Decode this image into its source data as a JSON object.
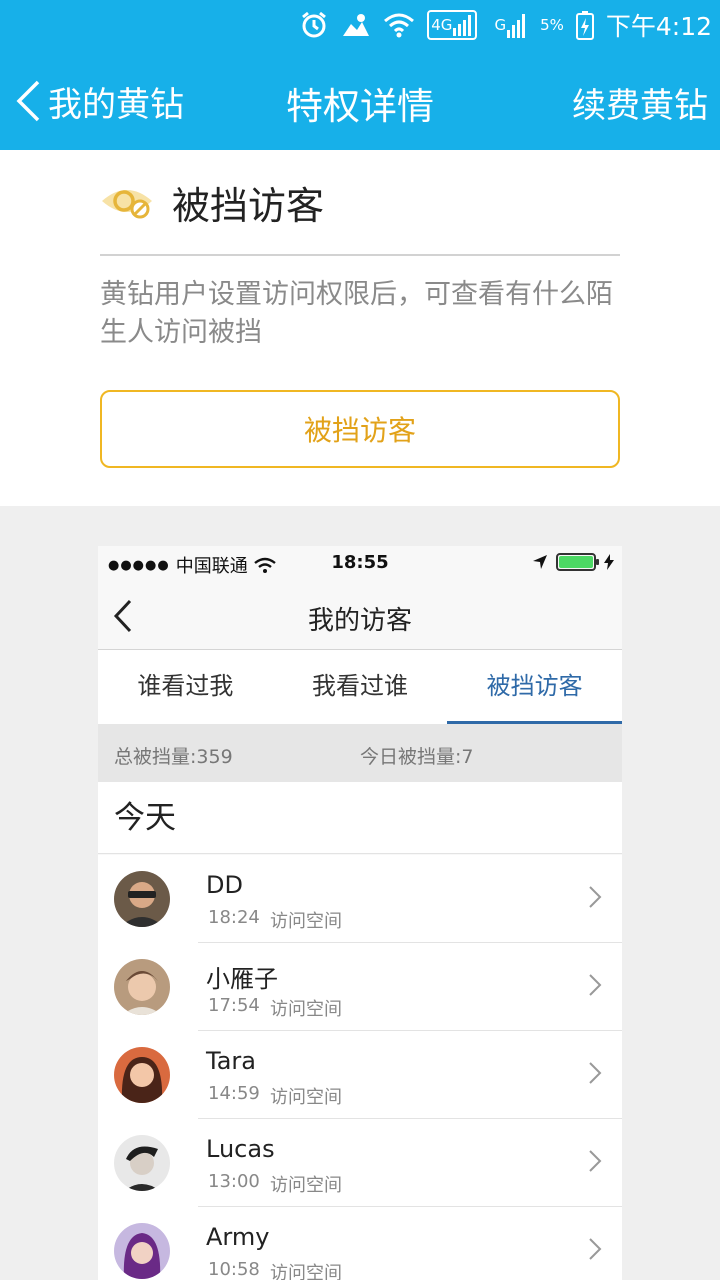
{
  "status_bar": {
    "network_4g": "4G",
    "network_g": "G",
    "battery": "5%",
    "time": "下午4:12"
  },
  "header": {
    "back_label": "我的黄钻",
    "title": "特权详情",
    "action_label": "续费黄钻"
  },
  "privilege": {
    "title": "被挡访客",
    "description": "黄钻用户设置访问权限后，可查看有什么陌生人访问被挡",
    "button_label": "被挡访客",
    "accent_color": "#f0b723"
  },
  "preview": {
    "status": {
      "signal_dots": "●●●●●",
      "carrier": "中国联通",
      "time": "18:55"
    },
    "nav_title": "我的访客",
    "tabs": [
      {
        "label": "谁看过我",
        "active": false
      },
      {
        "label": "我看过谁",
        "active": false
      },
      {
        "label": "被挡访客",
        "active": true
      }
    ],
    "stats": {
      "total": "总被挡量:359",
      "today": "今日被挡量:7"
    },
    "section_title": "今天",
    "visitors": [
      {
        "name": "DD",
        "time": "18:24",
        "action": "访问空间",
        "avatar_color": "#5b4a3a"
      },
      {
        "name": "小雁子",
        "time": "17:54",
        "action": "访问空间",
        "avatar_color": "#8a6a52"
      },
      {
        "name": "Tara",
        "time": "14:59",
        "action": "访问空间",
        "avatar_color": "#c0503a"
      },
      {
        "name": "Lucas",
        "time": "13:00",
        "action": "访问空间",
        "avatar_color": "#3b3b3b"
      },
      {
        "name": "Army",
        "time": "10:58",
        "action": "访问空间",
        "avatar_color": "#7a3a8a"
      }
    ]
  }
}
